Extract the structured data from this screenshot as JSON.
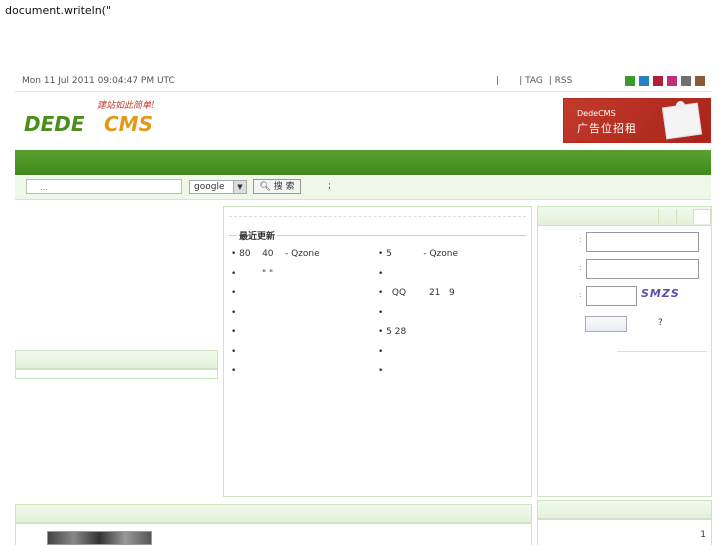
{
  "code_text": "document.writeln(\"",
  "topbar": {
    "date": "Mon 11 Jul 2011 09:04:47 PM UTC",
    "sep1": "|",
    "sep2": "| TAG",
    "sep3": "| RSS",
    "swatch_colors": [
      "#3a9a2a",
      "#2a7fc0",
      "#b0203a",
      "#c0307a",
      "#707070",
      "#8a5a3a"
    ]
  },
  "logo": {
    "slogan": "建站如此简单!",
    "brand_left": "DEDE",
    "brand_right": "CMS"
  },
  "ad": {
    "line1": "DedeCMS",
    "line2": "广告位招租"
  },
  "search": {
    "placeholder": "...",
    "engine": "google",
    "button_label": "搜 索",
    "semicolon": ";"
  },
  "latest": {
    "heading": "最近更新",
    "left": [
      "• 80    40    - Qzone",
      "•         \" \"",
      "•",
      "•",
      "•",
      "•",
      "•"
    ],
    "right": [
      "• 5           - Qzone",
      "•",
      "•   QQ        21   9",
      "•",
      "• 5 28",
      "•",
      "•"
    ]
  },
  "login": {
    "label_user": ":",
    "label_pass": ":",
    "label_code": ":",
    "captcha": "SMZS",
    "question": "?"
  },
  "bottom": {
    "page_number": "1"
  }
}
